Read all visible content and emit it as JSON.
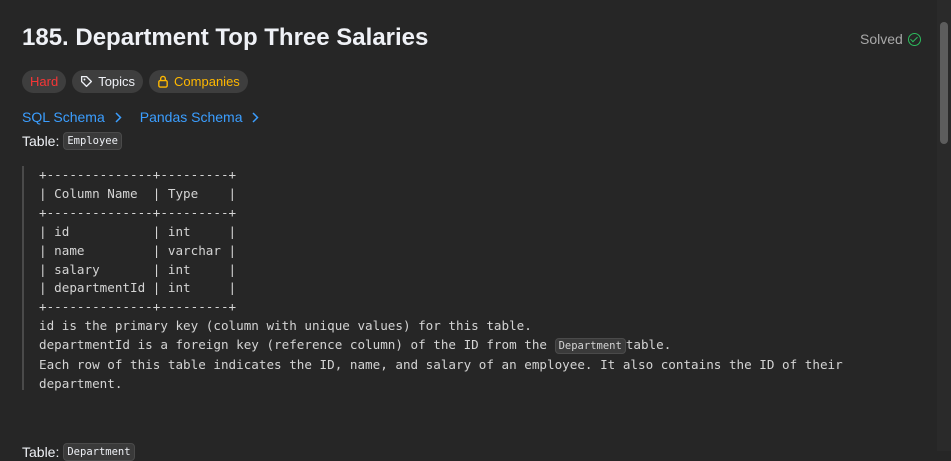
{
  "problem": {
    "title": "185. Department Top Three Salaries",
    "status": "Solved"
  },
  "tags": {
    "difficulty": "Hard",
    "topics": "Topics",
    "companies": "Companies"
  },
  "schema_links": [
    "SQL Schema",
    "Pandas Schema"
  ],
  "table1": {
    "label": "Table:",
    "name": "Employee"
  },
  "schema_text": {
    "lines": [
      "+--------------+---------+",
      "| Column Name  | Type    |",
      "+--------------+---------+",
      "| id           | int     |",
      "| name         | varchar |",
      "| salary       | int     |",
      "| departmentId | int     |",
      "+--------------+---------+",
      "id is the primary key (column with unique values) for this table."
    ],
    "fk_prefix": "departmentId is a foreign key (reference column) of the ID from the ",
    "fk_code": "Department",
    "fk_suffix": "table.",
    "desc_line1": "Each row of this table indicates the ID, name, and salary of an employee. It also contains the ID of their",
    "desc_line2": "department."
  },
  "table2": {
    "label": "Table:",
    "name": "Department"
  },
  "colors": {
    "background": "#262626",
    "hard": "#f63636",
    "companies": "#ffb800",
    "link": "#3b9eff",
    "solved_check": "#2cbb5d"
  }
}
